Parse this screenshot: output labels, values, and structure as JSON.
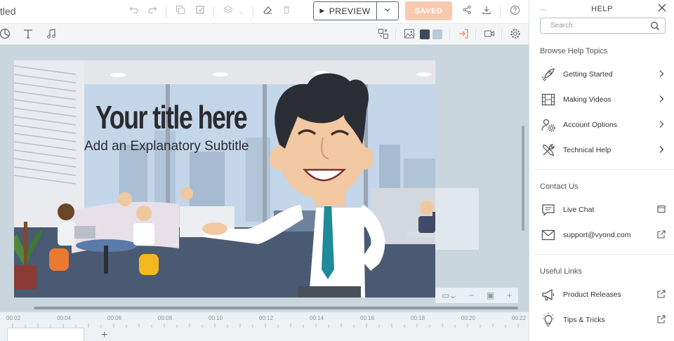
{
  "app": {
    "doc_title": "tled"
  },
  "toolbar": {
    "preview_label": "PREVIEW",
    "saved_label": "SAVED"
  },
  "scene": {
    "title": "Your title here",
    "subtitle": "Add an Explanatory Subtitle"
  },
  "timeline": {
    "ticks": [
      "00:02",
      "00:04",
      "00:06",
      "00:08",
      "00:10",
      "00:12",
      "00:14",
      "00:16",
      "00:18",
      "00:20",
      "00:22"
    ]
  },
  "colors": {
    "accent": "#f8c9ae",
    "swatch_dark": "#3d4a5c",
    "swatch_light": "#b9c8da"
  },
  "help": {
    "title": "HELP",
    "search_placeholder": "Search",
    "browse": {
      "title": "Browse Help Topics",
      "items": [
        {
          "label": "Getting Started",
          "icon": "rocket-icon"
        },
        {
          "label": "Making Videos",
          "icon": "film-icon"
        },
        {
          "label": "Account Options",
          "icon": "account-settings-icon"
        },
        {
          "label": "Technical Help",
          "icon": "tools-icon"
        }
      ]
    },
    "contact": {
      "title": "Contact Us",
      "items": [
        {
          "label": "Live Chat",
          "icon": "chat-icon"
        },
        {
          "label": "support@vyond.com",
          "icon": "mail-icon"
        }
      ]
    },
    "links": {
      "title": "Useful Links",
      "items": [
        {
          "label": "Product Releases",
          "icon": "megaphone-icon"
        },
        {
          "label": "Tips & Tricks",
          "icon": "lightbulb-icon"
        }
      ]
    }
  }
}
